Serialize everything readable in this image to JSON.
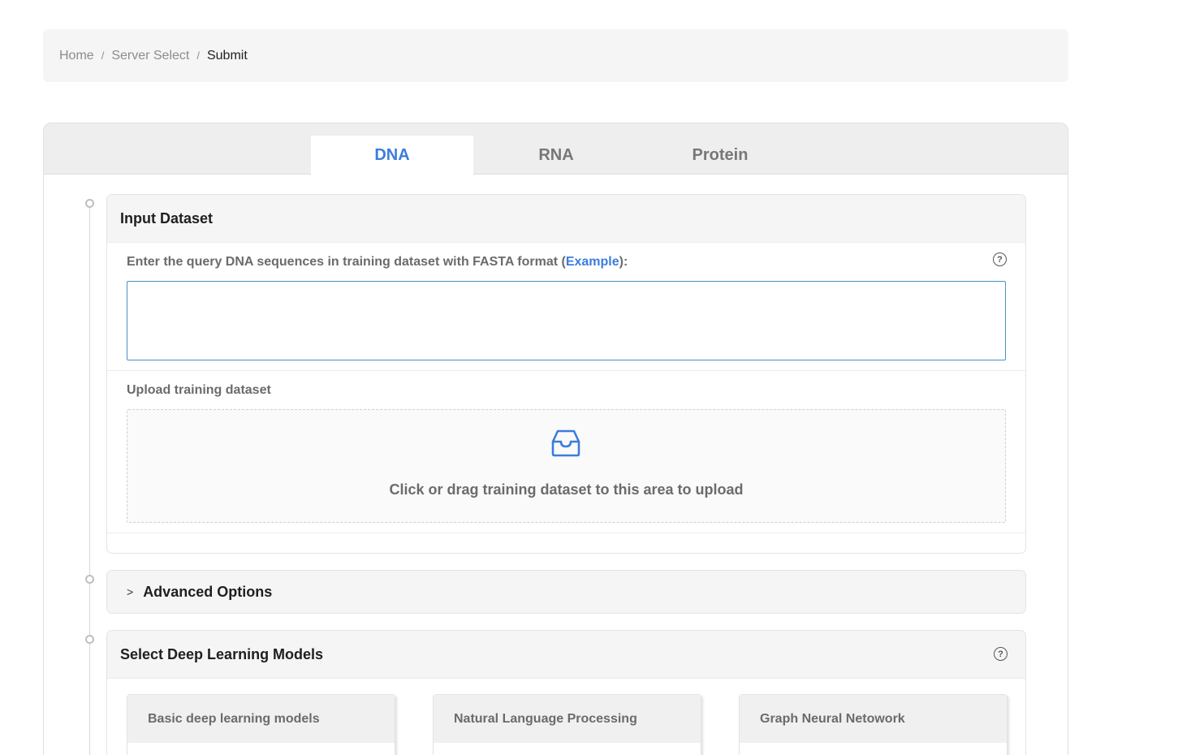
{
  "breadcrumb": {
    "items": [
      "Home",
      "Server Select"
    ],
    "current": "Submit",
    "separator": "/"
  },
  "tabs": [
    {
      "label": "DNA",
      "active": true
    },
    {
      "label": "RNA",
      "active": false
    },
    {
      "label": "Protein",
      "active": false
    }
  ],
  "input_dataset": {
    "title": "Input Dataset",
    "query_label_prefix": "Enter the query DNA sequences in training dataset with FASTA format (",
    "example_link": "Example",
    "query_label_suffix": "):",
    "query_value": "",
    "upload_label": "Upload training dataset",
    "upload_hint": "Click or drag training dataset to this area to upload",
    "upload_icon": "inbox-icon"
  },
  "advanced_options": {
    "title": "Advanced Options",
    "expanded": false
  },
  "models": {
    "title": "Select Deep Learning Models",
    "groups": [
      {
        "title": "Basic deep learning models"
      },
      {
        "title": "Natural Language Processing"
      },
      {
        "title": "Graph Neural Netowork"
      }
    ]
  },
  "colors": {
    "accent": "#3b7ddd",
    "input_border": "#4a90c4",
    "panel_bg": "#f5f5f5"
  }
}
